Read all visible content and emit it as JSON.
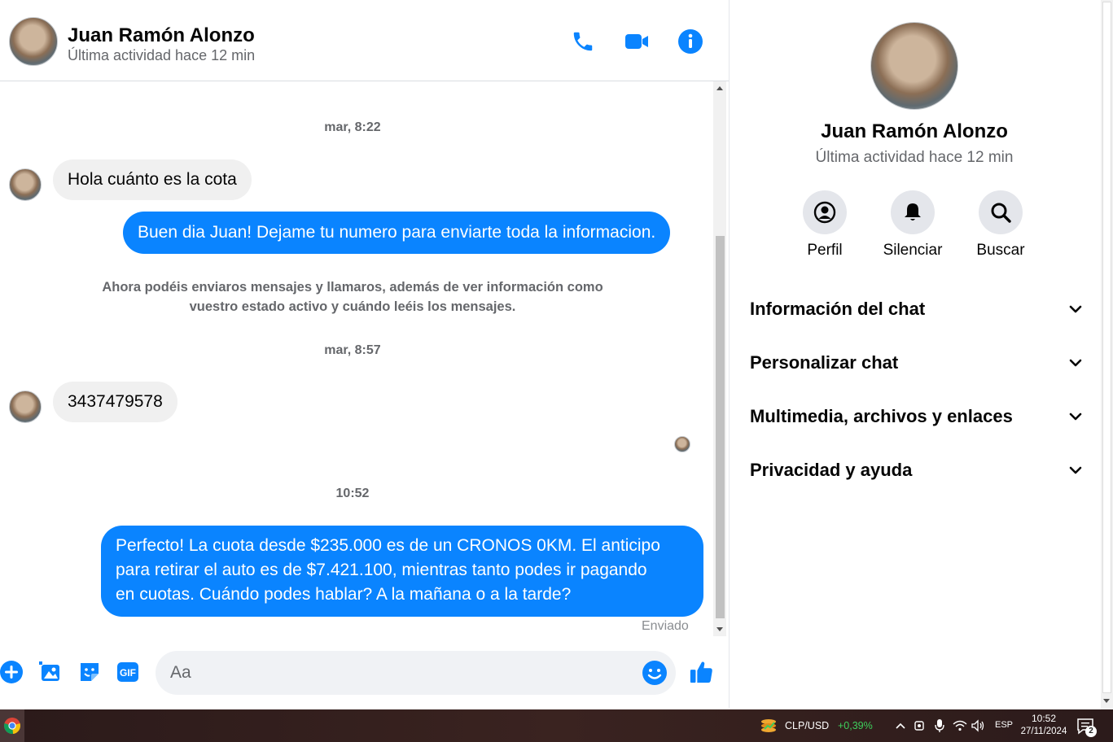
{
  "header": {
    "name": "Juan Ramón Alonzo",
    "status": "Última actividad hace 12 min",
    "icons": [
      "phone-icon",
      "video-camera-icon",
      "info-icon"
    ]
  },
  "messages": {
    "timestamps": [
      "mar, 8:22",
      "mar, 8:57",
      "10:52"
    ],
    "items": [
      {
        "from": "contact",
        "text": "Hola cuánto es la cota"
      },
      {
        "from": "me",
        "text": "Buen dia Juan! Dejame tu numero para enviarte toda la informacion."
      },
      {
        "from": "contact",
        "text": "3437479578"
      },
      {
        "from": "me",
        "lines": [
          "Perfecto! La cuota desde $235.000 es de un CRONOS 0KM. El anticipo",
          "para retirar el auto es de $7.421.100, mientras tanto podes ir pagando",
          "en cuotas. Cuándo podes hablar? A la mañana o a la tarde?"
        ]
      }
    ],
    "system_note": [
      "Ahora podéis enviaros mensajes y llamaros, además de ver información como",
      "vuestro estado activo y cuándo leéis los mensajes."
    ],
    "sent_label": "Enviado"
  },
  "composer": {
    "placeholder": "Aa",
    "icons": [
      "plus-icon",
      "image-icon",
      "sticker-icon",
      "gif-icon",
      "emoji-icon",
      "thumbs-up-icon"
    ],
    "gif_label": "GIF"
  },
  "panel": {
    "name": "Juan Ramón Alonzo",
    "status": "Última actividad hace 12 min",
    "actions": [
      {
        "label": "Perfil",
        "icon": "profile-icon"
      },
      {
        "label": "Silenciar",
        "icon": "bell-icon"
      },
      {
        "label": "Buscar",
        "icon": "search-icon"
      }
    ],
    "sections": [
      "Información del chat",
      "Personalizar chat",
      "Multimedia, archivos y enlaces",
      "Privacidad y ayuda"
    ]
  },
  "taskbar": {
    "ticker_pair": "CLP/USD",
    "ticker_change": "+0,39%",
    "language": "ESP",
    "time": "10:52",
    "date": "27/11/2024",
    "notifications": "2"
  },
  "colors": {
    "accent": "#0a84ff",
    "incoming_bubble": "#f0f0f0",
    "muted_text": "#65676b",
    "ticker_up": "#3ecf5c"
  }
}
